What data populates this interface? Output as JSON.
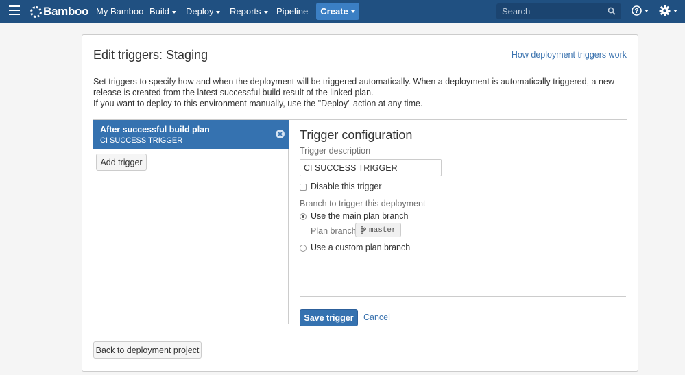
{
  "topbar": {
    "logo": "Bamboo",
    "nav": [
      "My Bamboo",
      "Build",
      "Deploy",
      "Reports",
      "Pipeline"
    ],
    "create_label": "Create",
    "search_placeholder": "Search",
    "colors": {
      "nav_bg": "#205081",
      "create_bg": "#3b7fc4"
    }
  },
  "page": {
    "title": "Edit triggers: Staging",
    "help_link": "How deployment triggers work",
    "description_1": "Set triggers to specify how and when the deployment will be triggered automatically. When a deployment is automatically triggered, a new release is created from the latest successful build result of the linked plan.",
    "description_2": "If you want to deploy to this environment manually, use the \"Deploy\" action at any time."
  },
  "triggers": {
    "items": [
      {
        "name": "After successful build plan",
        "description": "CI SUCCESS TRIGGER"
      }
    ],
    "add_label": "Add trigger"
  },
  "config": {
    "title": "Trigger configuration",
    "description_label": "Trigger description",
    "description_value": "CI SUCCESS TRIGGER",
    "disable_label": "Disable this trigger",
    "branch_label": "Branch to trigger this deployment",
    "main_branch_option": "Use the main plan branch",
    "plan_branch_label": "Plan branch",
    "plan_branch_value": "master",
    "custom_branch_option": "Use a custom plan branch",
    "save_label": "Save trigger",
    "cancel_label": "Cancel"
  },
  "footer": {
    "back_label": "Back to deployment project"
  }
}
